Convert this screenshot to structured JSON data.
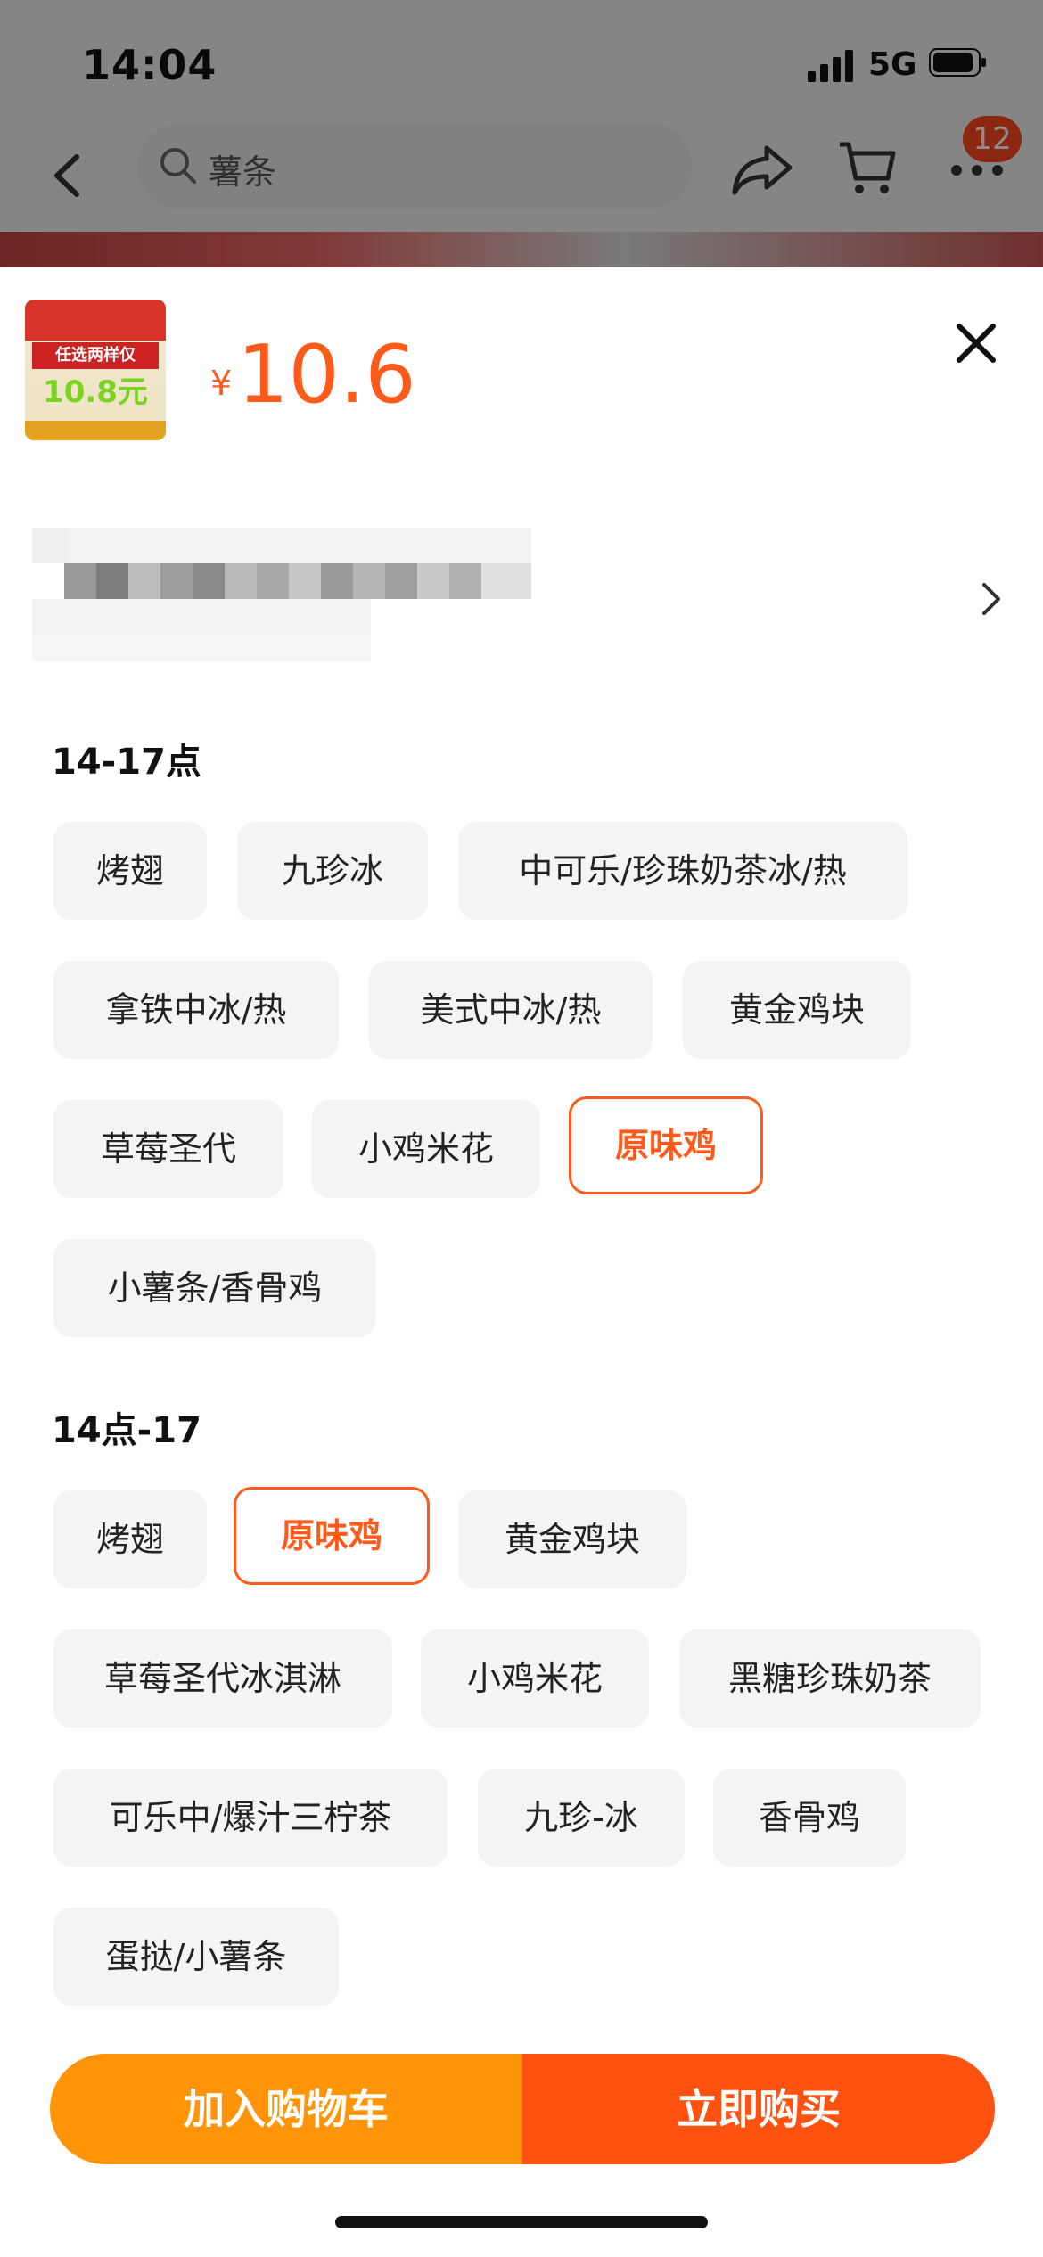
{
  "status_bar": {
    "time": "14:04",
    "network": "5G"
  },
  "nav": {
    "search_placeholder": "薯条",
    "cart_badge": "12"
  },
  "sheet": {
    "price_symbol": "¥",
    "price": "10.6",
    "thumbnail": {
      "headline": "任选两样仅",
      "price_text": "10.8元"
    },
    "groups": [
      {
        "title": "14-17点",
        "options": [
          {
            "label": "烤翅",
            "selected": false
          },
          {
            "label": "九珍冰",
            "selected": false
          },
          {
            "label": "中可乐/珍珠奶茶冰/热",
            "selected": false
          },
          {
            "label": "拿铁中冰/热",
            "selected": false
          },
          {
            "label": "美式中冰/热",
            "selected": false
          },
          {
            "label": "黄金鸡块",
            "selected": false
          },
          {
            "label": "草莓圣代",
            "selected": false
          },
          {
            "label": "小鸡米花",
            "selected": false
          },
          {
            "label": "原味鸡",
            "selected": true
          },
          {
            "label": "小薯条/香骨鸡",
            "selected": false
          }
        ]
      },
      {
        "title": "14点-17",
        "options": [
          {
            "label": "烤翅",
            "selected": false
          },
          {
            "label": "原味鸡",
            "selected": true
          },
          {
            "label": "黄金鸡块",
            "selected": false
          },
          {
            "label": "草莓圣代冰淇淋",
            "selected": false
          },
          {
            "label": "小鸡米花",
            "selected": false
          },
          {
            "label": "黑糖珍珠奶茶",
            "selected": false
          },
          {
            "label": "可乐中/爆汁三柠茶",
            "selected": false
          },
          {
            "label": "九珍-冰",
            "selected": false
          },
          {
            "label": "香骨鸡",
            "selected": false
          },
          {
            "label": "蛋挞/小薯条",
            "selected": false
          }
        ]
      }
    ],
    "add_to_cart_label": "加入购物车",
    "buy_now_label": "立即购买"
  },
  "colors": {
    "accent": "#ff5a1a",
    "cart_button": "#ff9408",
    "buy_button": "#ff5211",
    "chip_bg": "#f4f4f4"
  }
}
